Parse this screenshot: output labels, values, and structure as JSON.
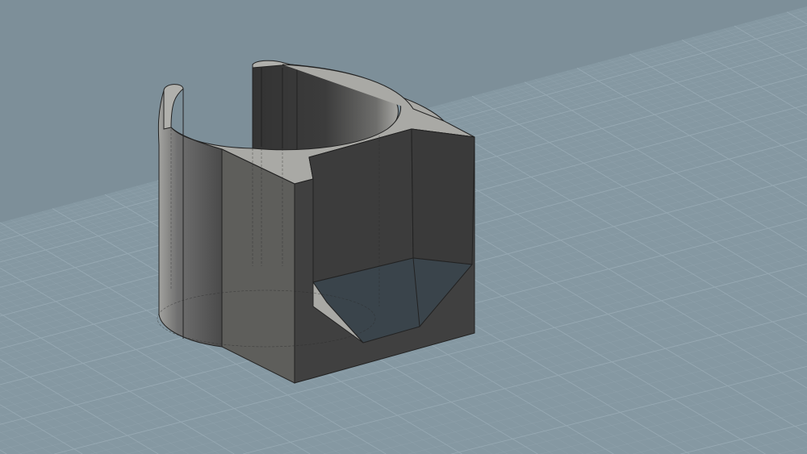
{
  "viewport": {
    "view": "perspective-3d",
    "colors": {
      "background": "#7d8f99",
      "grid_plane": "#8598a2",
      "grid_line": "#97a9b3",
      "model_dark": "#3e3e3e",
      "model_mid": "#5c5c5a",
      "model_light": "#a9a9a5",
      "edge": "#1e1e1e",
      "cutout_floor": "#3a444b"
    }
  }
}
